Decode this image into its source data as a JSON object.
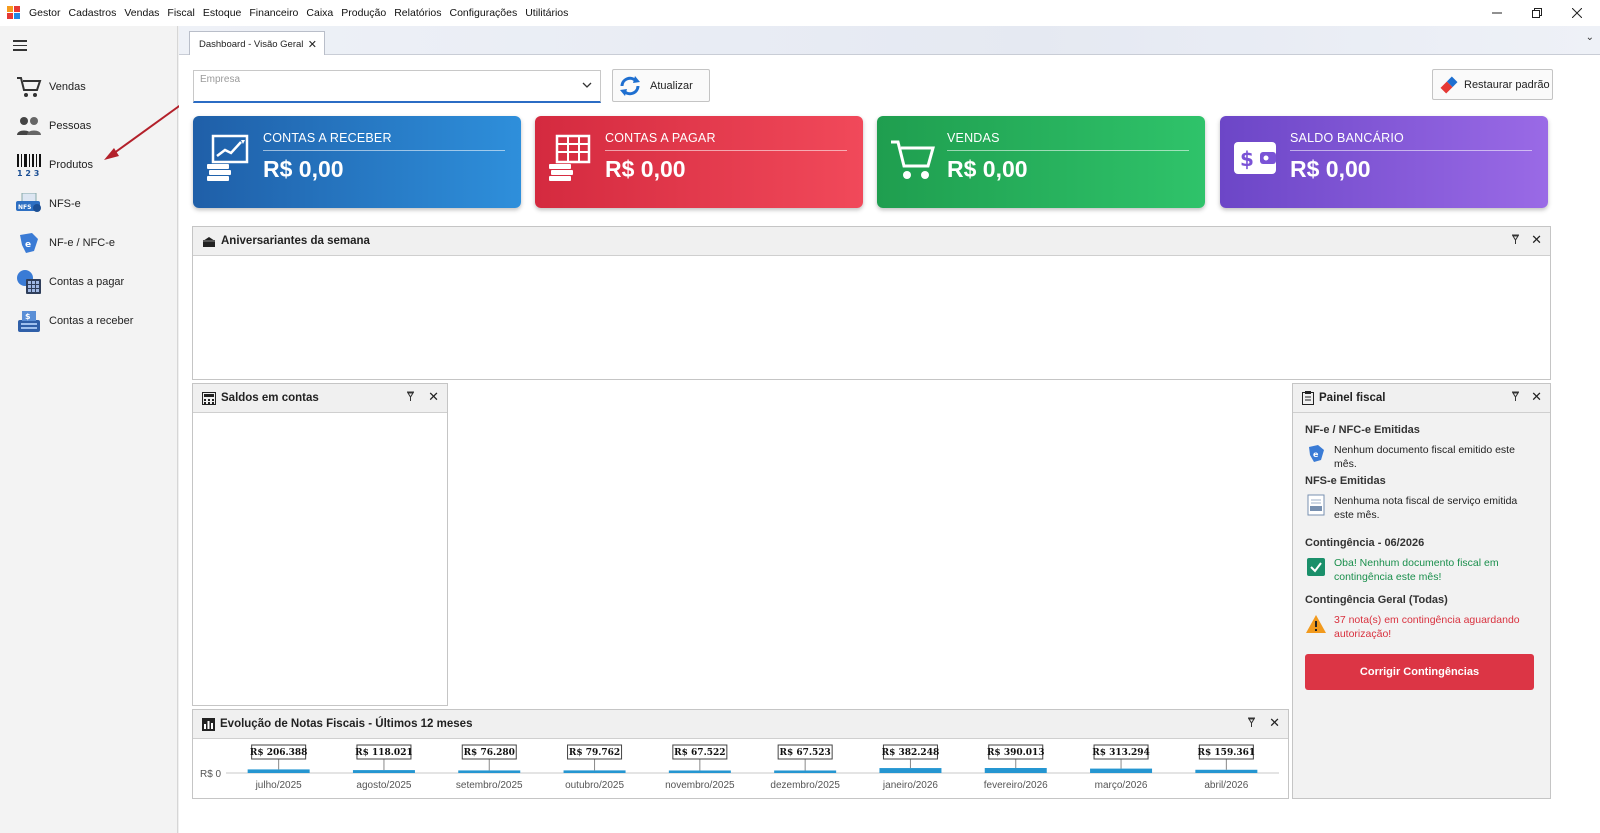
{
  "menubar": {
    "app_name": "Gestor",
    "items": [
      "Cadastros",
      "Vendas",
      "Fiscal",
      "Estoque",
      "Financeiro",
      "Caixa",
      "Produção",
      "Relatórios",
      "Configurações",
      "Utilitários"
    ]
  },
  "sidebar": {
    "items": [
      {
        "label": "Vendas",
        "icon": "cart-icon"
      },
      {
        "label": "Pessoas",
        "icon": "people-icon"
      },
      {
        "label": "Produtos",
        "icon": "barcode-icon"
      },
      {
        "label": "NFS-e",
        "icon": "nfse-icon"
      },
      {
        "label": "NF-e / NFC-e",
        "icon": "nfe-icon"
      },
      {
        "label": "Contas a pagar",
        "icon": "calculator-globe-icon"
      },
      {
        "label": "Contas a receber",
        "icon": "money-register-icon"
      }
    ]
  },
  "tabs": [
    {
      "label": "Dashboard - Visão Geral",
      "active": true
    }
  ],
  "toolbar": {
    "empresa_placeholder": "Empresa",
    "atualizar_label": "Atualizar",
    "restaurar_label": "Restaurar padrão"
  },
  "kpis": [
    {
      "title": "CONTAS A RECEBER",
      "value": "R$ 0,00",
      "color_from": "#1f5fa8",
      "color_to": "#2e8fdb"
    },
    {
      "title": "CONTAS A PAGAR",
      "value": "R$ 0,00",
      "color_from": "#d42a3f",
      "color_to": "#f1495a"
    },
    {
      "title": "VENDAS",
      "value": "R$ 0,00",
      "color_from": "#1f9e4f",
      "color_to": "#2fc36a"
    },
    {
      "title": "SALDO BANCÁRIO",
      "value": "R$ 0,00",
      "color_from": "#6c46c7",
      "color_to": "#9a6ae6"
    }
  ],
  "panels": {
    "aniversariantes": {
      "title": "Aniversariantes da semana"
    },
    "saldos": {
      "title": "Saldos em contas"
    },
    "fiscal": {
      "title": "Painel fiscal",
      "nfe_heading": "NF-e / NFC-e Emitidas",
      "nfe_text": "Nenhum documento fiscal emitido este mês.",
      "nfse_heading": "NFS-e Emitidas",
      "nfse_text": "Nenhuma nota fiscal de serviço emitida este mês.",
      "contingencia_heading": "Contingência - 06/2026",
      "contingencia_text": "Oba! Nenhum documento fiscal em contingência este mês!",
      "contingencia_geral_heading": "Contingência Geral (Todas)",
      "contingencia_geral_text": "37 nota(s) em contingência aguardando autorização!",
      "corrigir_label": "Corrigir Contingências",
      "ok_color": "#1a8f4c",
      "warn_color": "#d9323f"
    },
    "evolucao": {
      "title": "Evolução de Notas Fiscais - Últimos 12 meses"
    }
  },
  "chart_data": {
    "type": "bar",
    "title": "Evolução de Notas Fiscais - Últimos 12 meses",
    "y_tick_label": "R$ 0",
    "categories": [
      "julho/2025",
      "agosto/2025",
      "setembro/2025",
      "outubro/2025",
      "novembro/2025",
      "dezembro/2025",
      "janeiro/2026",
      "fevereiro/2026",
      "março/2026",
      "abril/2026"
    ],
    "values": [
      206388,
      118021,
      76280,
      79762,
      67522,
      67523,
      382248,
      390013,
      313294,
      159361
    ],
    "value_labels": [
      "R$ 206.388",
      "R$ 118.021",
      "R$ 76.280",
      "R$ 79.762",
      "R$ 67.522",
      "R$ 67.523",
      "R$ 382.248",
      "R$ 390.013",
      "R$ 313.294",
      "R$ 159.361"
    ],
    "bar_color": "#2596d1"
  }
}
